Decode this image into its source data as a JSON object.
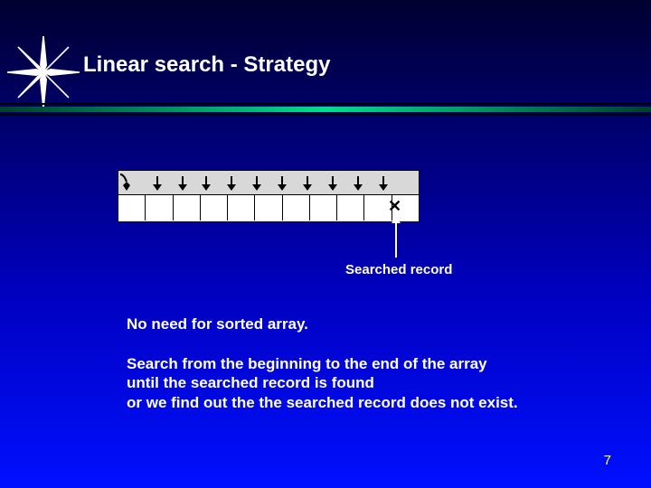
{
  "title": "Linear search   -   Strategy",
  "diagram": {
    "searched_label": "Searched record",
    "cells": 11,
    "found_index": 10
  },
  "body": {
    "line1": "No need for sorted array.",
    "line2": "Search from the beginning to the end of the array\nuntil the searched record is found\nor we find out the the searched record does not exist."
  },
  "page_number": "7"
}
